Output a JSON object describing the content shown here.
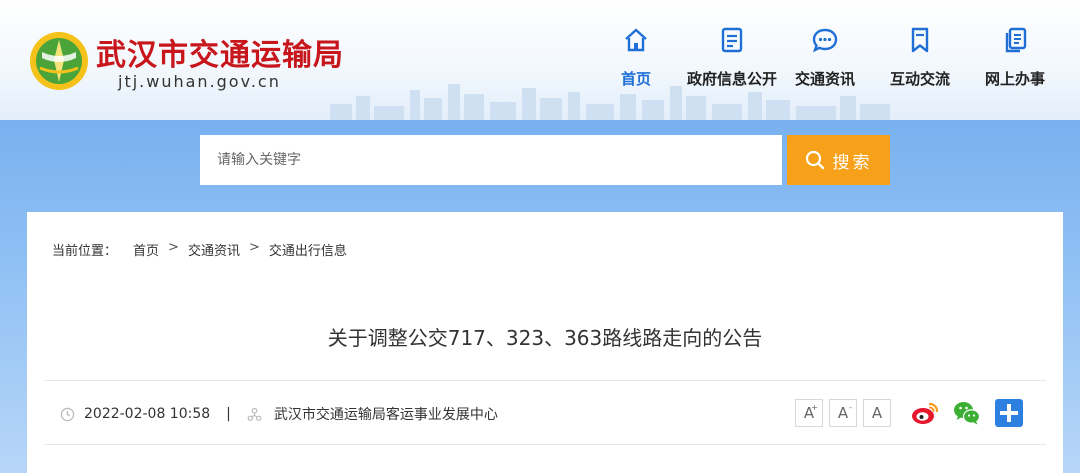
{
  "site": {
    "name": "武汉市交通运输局",
    "domain": "jtj.wuhan.gov.cn"
  },
  "nav": {
    "items": [
      {
        "label": "首页",
        "icon": "home-icon",
        "active": true
      },
      {
        "label": "政府信息公开",
        "icon": "document-icon",
        "active": false
      },
      {
        "label": "交通资讯",
        "icon": "chat-icon",
        "active": false
      },
      {
        "label": "互动交流",
        "icon": "bookmark-icon",
        "active": false
      },
      {
        "label": "网上办事",
        "icon": "files-icon",
        "active": false
      }
    ]
  },
  "search": {
    "placeholder": "请输入关键字",
    "button_label": "搜索"
  },
  "breadcrumb": {
    "prefix": "当前位置：",
    "items": [
      "首页",
      "交通资讯",
      "交通出行信息"
    ],
    "separator": ">"
  },
  "article": {
    "title": "关于调整公交717、323、363路线路走向的公告",
    "datetime": "2022-02-08 10:58",
    "separator": "|",
    "source": "武汉市交通运输局客运事业发展中心"
  },
  "font_size": {
    "increase": "A",
    "default": "A",
    "decrease": "A",
    "increase_mark": "+",
    "default_mark": "-"
  },
  "share": [
    "weibo-icon",
    "wechat-icon",
    "plus-share-icon"
  ],
  "colors": {
    "brand_red": "#c8161d",
    "nav_active": "#1f6fd6",
    "search_button": "#f7a11a",
    "band_blue": "#8fc0f4"
  }
}
